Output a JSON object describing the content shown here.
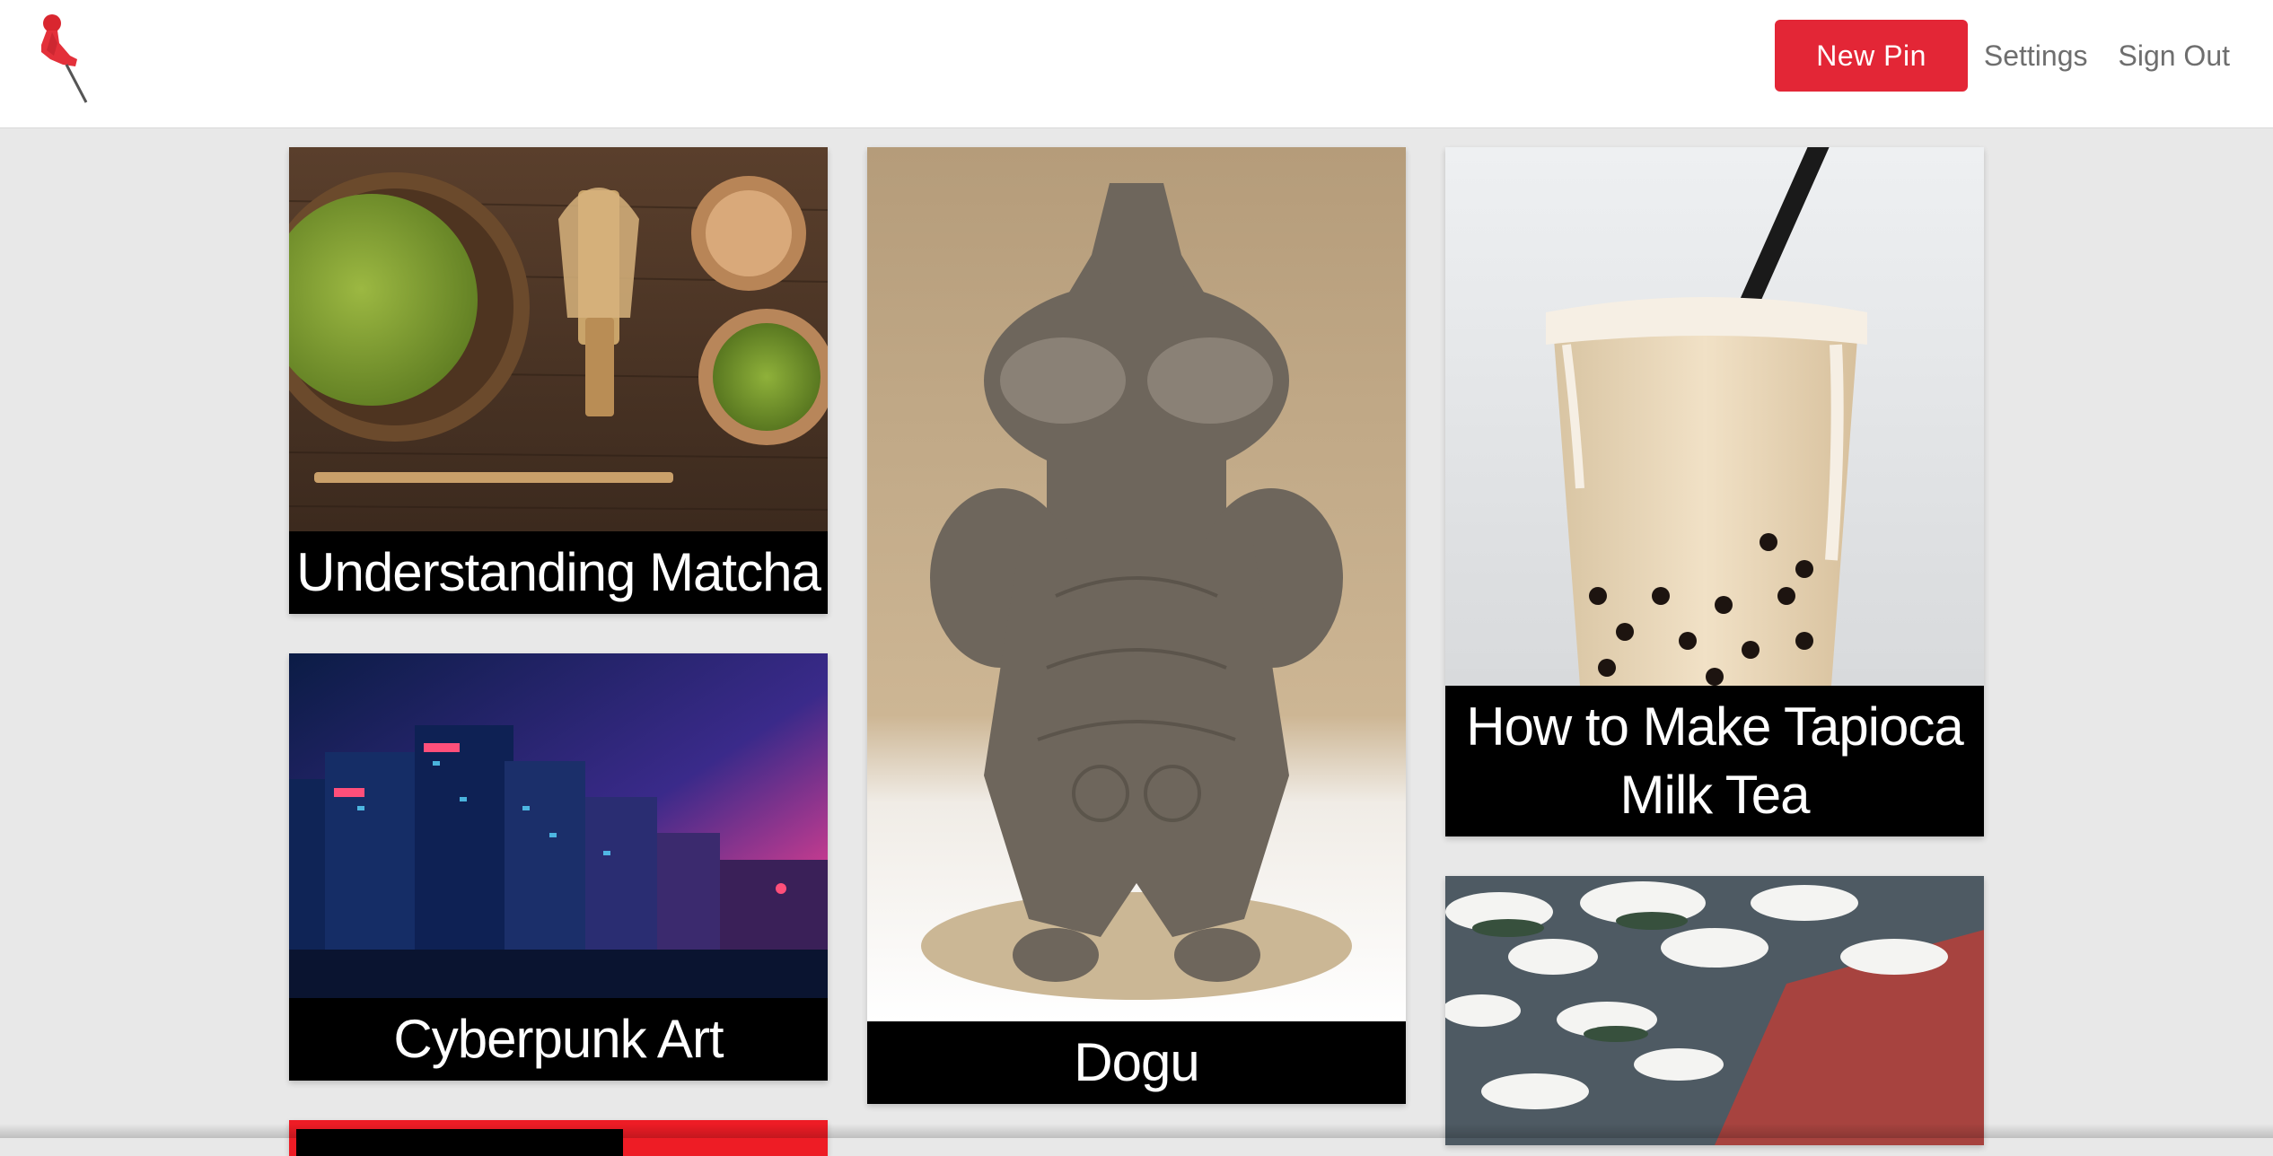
{
  "app": {
    "logo_icon": "pushpin-icon",
    "brand_color": "#e32636"
  },
  "nav": {
    "new_pin_label": "New Pin",
    "settings_label": "Settings",
    "signout_label": "Sign Out"
  },
  "pins": [
    {
      "title": "Understanding Matcha",
      "image": "matcha-tea-set-photo"
    },
    {
      "title": "Cyberpunk Art",
      "image": "cyberpunk-city-illustration"
    },
    {
      "title": "Dogu",
      "image": "dogu-clay-figurine-photo"
    },
    {
      "title": "How to Make Tapioca Milk Tea",
      "image": "tapioca-milk-tea-photo"
    },
    {
      "title": "",
      "image": "snowy-pine-woodblock-print"
    },
    {
      "title": "",
      "image": "red-pin-card"
    }
  ]
}
